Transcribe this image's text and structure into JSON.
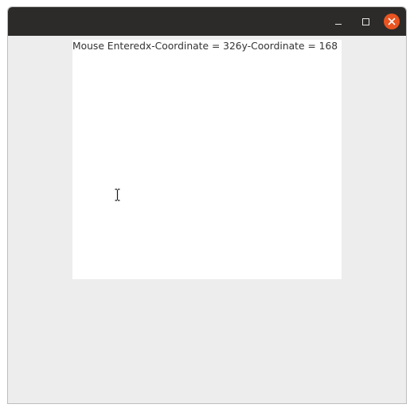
{
  "window": {
    "titlebar": {
      "minimize_icon": "minimize-icon",
      "maximize_icon": "maximize-icon",
      "close_icon": "close-icon",
      "close_color": "#e95420",
      "bar_color": "#2c2b2a"
    },
    "panel": {
      "status_text": "Mouse Enteredx-Coordinate = 326y-Coordinate = 168",
      "background": "#ffffff"
    },
    "cursor_icon": "text-cursor-icon",
    "background": "#ededed"
  }
}
